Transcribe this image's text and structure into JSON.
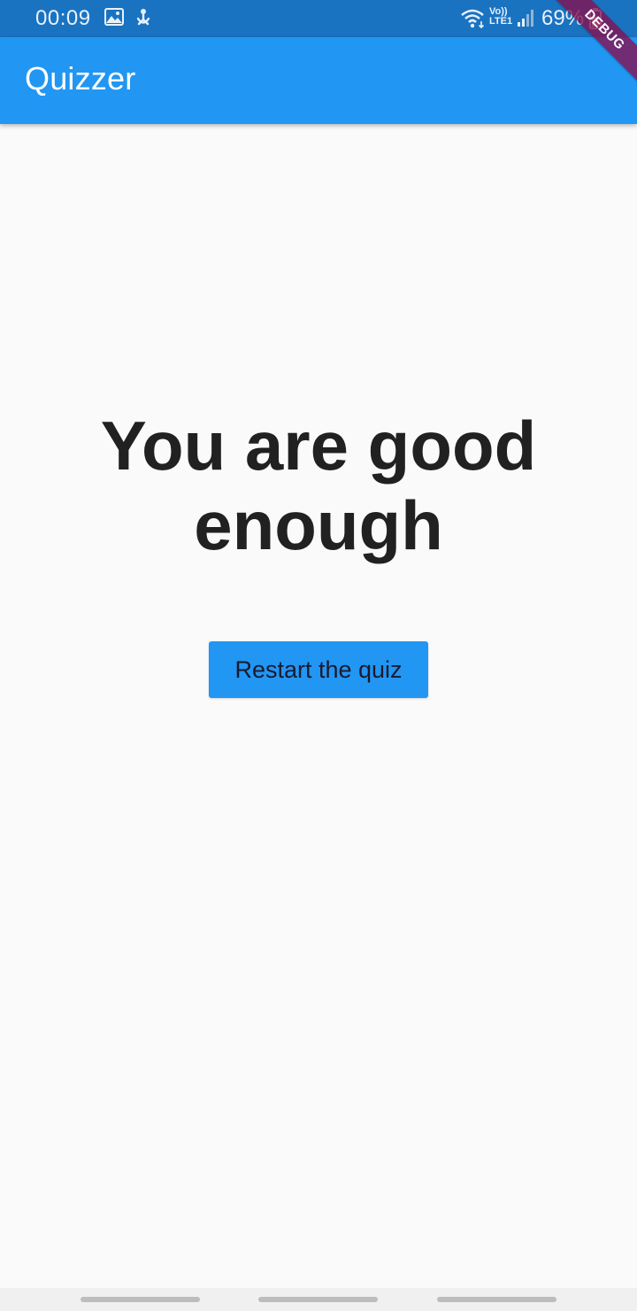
{
  "status_bar": {
    "time": "00:09",
    "battery_text": "69%",
    "network_top": "Vo))",
    "network_bottom": "LTE1",
    "icons": [
      "gallery-icon",
      "notification-icon",
      "wifi-icon",
      "signal-icon",
      "battery-icon"
    ]
  },
  "app_bar": {
    "title": "Quizzer"
  },
  "debug_banner": {
    "label": "DEBUG"
  },
  "result": {
    "message": "You are good enough"
  },
  "restart_button": {
    "label": "Restart the quiz"
  },
  "colors": {
    "primary": "#2196f3",
    "status_bar": "#1a73c1",
    "background": "#fafafa",
    "text": "#212121",
    "debug_banner": "#880e4f"
  }
}
